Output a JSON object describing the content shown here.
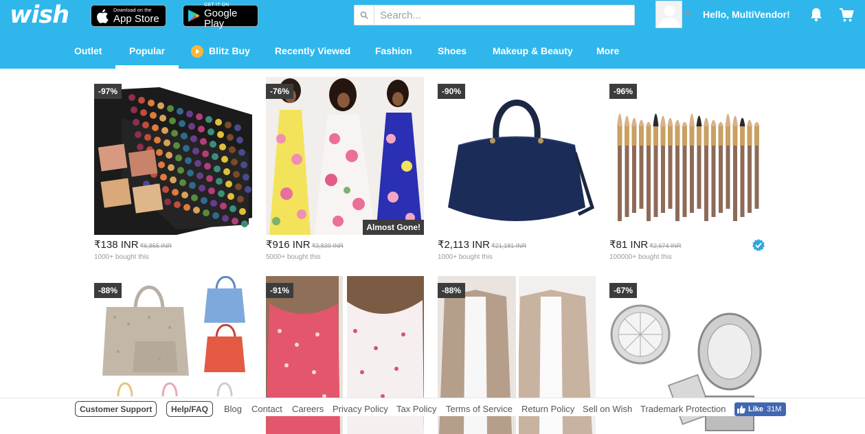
{
  "header": {
    "logo": "wish",
    "app_store": {
      "small": "Download on the",
      "big": "App Store"
    },
    "google_play": {
      "small": "GET IT ON",
      "big": "Google Play"
    },
    "search": {
      "placeholder": "Search...",
      "value": ""
    },
    "greeting": "Hello, MultiVendor!",
    "brand_color": "#2fb7ec"
  },
  "nav": {
    "items": [
      {
        "label": "Outlet",
        "active": false
      },
      {
        "label": "Popular",
        "active": true
      },
      {
        "label": "Blitz Buy",
        "active": false,
        "icon": "blitz-buy-icon"
      },
      {
        "label": "Recently Viewed",
        "active": false
      },
      {
        "label": "Fashion",
        "active": false
      },
      {
        "label": "Shoes",
        "active": false
      },
      {
        "label": "Makeup & Beauty",
        "active": false
      },
      {
        "label": "More",
        "active": false
      }
    ]
  },
  "products": [
    {
      "discount": "-97%",
      "price": "₹138 INR",
      "original": "₹6,855 INR",
      "bought": "1000+ bought this",
      "image": "eyeshadow-palette"
    },
    {
      "discount": "-76%",
      "price": "₹916 INR",
      "original": "₹3,839 INR",
      "bought": "5000+ bought this",
      "badge": "Almost Gone!",
      "image": "floral-maxi-dresses"
    },
    {
      "discount": "-90%",
      "price": "₹2,113 INR",
      "original": "₹21,181 INR",
      "bought": "1000+ bought this",
      "image": "navy-handbag"
    },
    {
      "discount": "-96%",
      "price": "₹81 INR",
      "original": "₹2,674 INR",
      "bought": "100000+ bought this",
      "verified": true,
      "image": "makeup-brushes"
    },
    {
      "discount": "-88%",
      "image": "tote-bags"
    },
    {
      "discount": "-91%",
      "image": "printed-camisoles"
    },
    {
      "discount": "-88%",
      "image": "knit-cardigans"
    },
    {
      "discount": "-67%",
      "image": "crystal-earrings"
    }
  ],
  "footer": {
    "buttons": [
      "Customer Support",
      "Help/FAQ"
    ],
    "links": [
      "Blog",
      "Contact",
      "Careers",
      "Privacy Policy",
      "Tax Policy",
      "Terms of Service",
      "Return Policy",
      "Sell on Wish",
      "Trademark Protection"
    ],
    "fb_like": {
      "label": "Like",
      "count": "31M"
    }
  }
}
